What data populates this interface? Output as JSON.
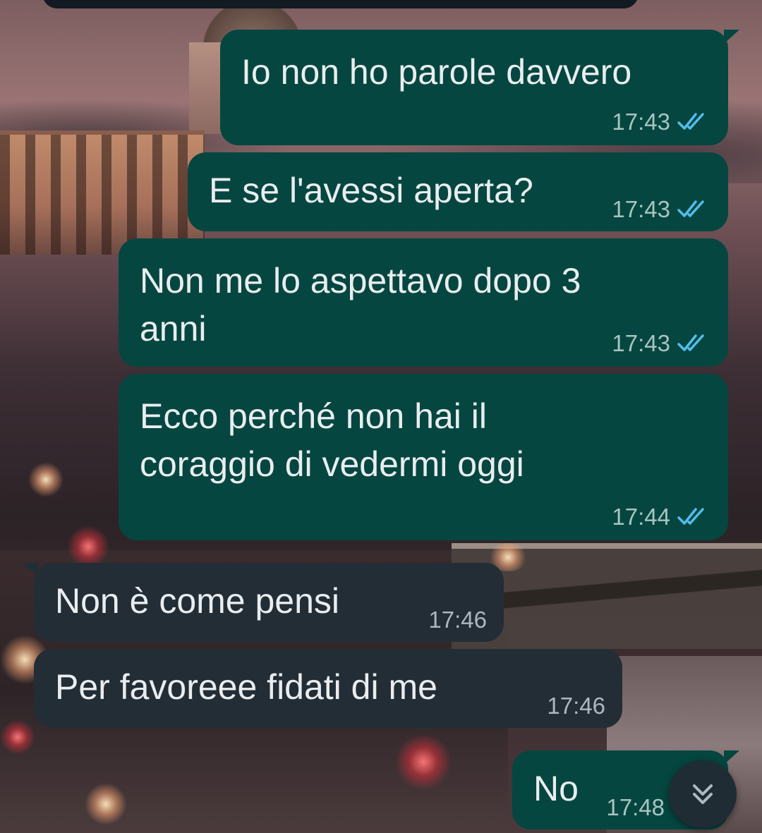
{
  "colors": {
    "outgoing_bubble": "#054640",
    "incoming_bubble": "#232d36",
    "text": "#e9edef",
    "read_ticks": "#53bdeb"
  },
  "messages": [
    {
      "direction": "outgoing",
      "text": "Io non ho parole davvero",
      "time": "17:43",
      "status": "read",
      "status_icon": "double-check-icon"
    },
    {
      "direction": "outgoing",
      "text": "E se l'avessi aperta?",
      "time": "17:43",
      "status": "read",
      "status_icon": "double-check-icon"
    },
    {
      "direction": "outgoing",
      "text": "Non me lo aspettavo dopo 3\nanni",
      "time": "17:43",
      "status": "read",
      "status_icon": "double-check-icon"
    },
    {
      "direction": "outgoing",
      "text": "Ecco perché non hai il\ncoraggio di vedermi oggi",
      "time": "17:44",
      "status": "read",
      "status_icon": "double-check-icon"
    },
    {
      "direction": "incoming",
      "text": "Non è come pensi",
      "time": "17:46"
    },
    {
      "direction": "incoming",
      "text": "Per favoreee fidati di me",
      "time": "17:46"
    },
    {
      "direction": "outgoing",
      "text": "No",
      "time": "17:48"
    }
  ],
  "scroll_button": {
    "icon": "double-chevron-down-icon"
  }
}
